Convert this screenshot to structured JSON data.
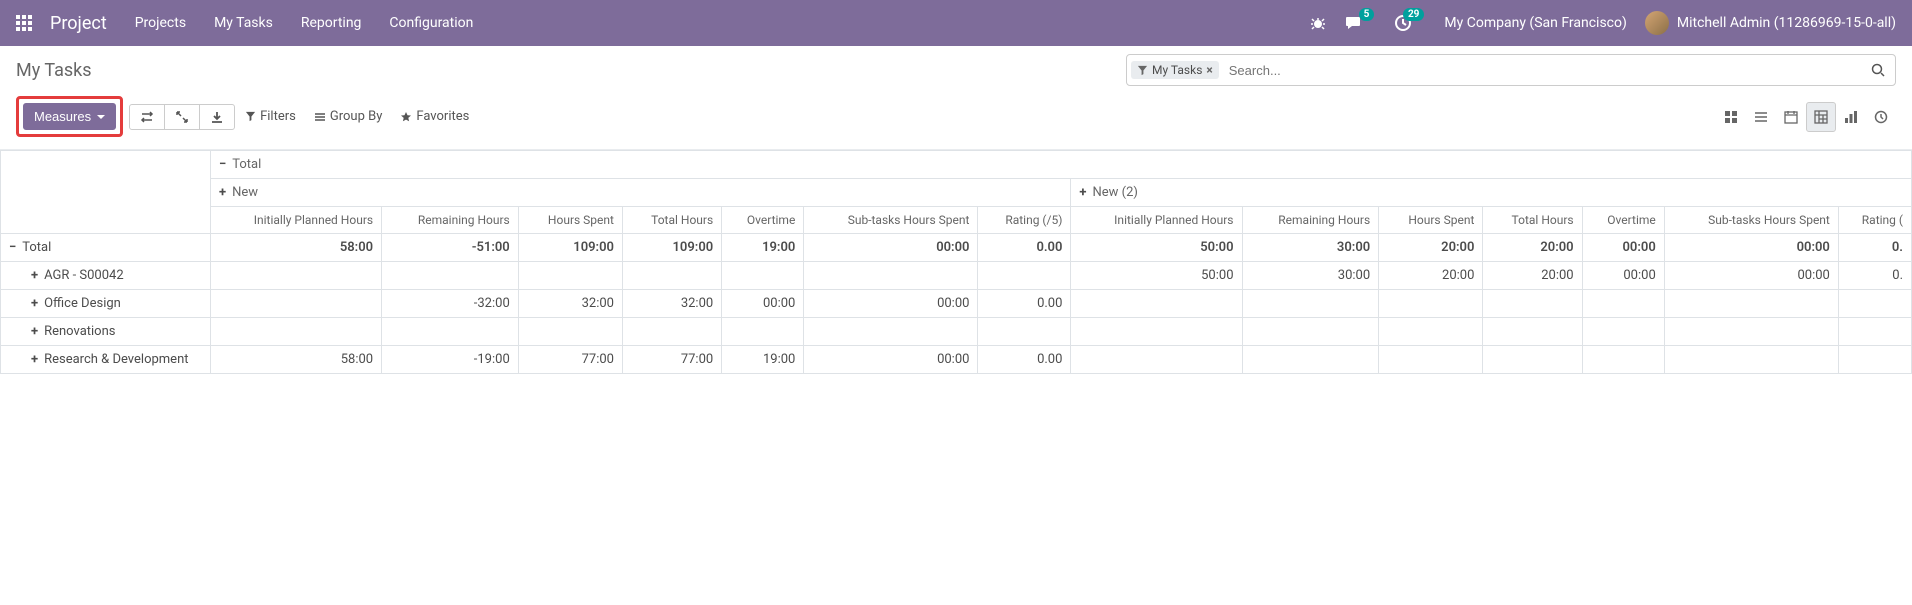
{
  "navbar": {
    "brand": "Project",
    "items": [
      "Projects",
      "My Tasks",
      "Reporting",
      "Configuration"
    ],
    "msg_badge": "5",
    "activity_badge": "29",
    "company": "My Company (San Francisco)",
    "user": "Mitchell Admin (11286969-15-0-all)"
  },
  "breadcrumb": "My Tasks",
  "search": {
    "tag": "My Tasks",
    "placeholder": "Search..."
  },
  "toolbar": {
    "measures": "Measures",
    "filters": "Filters",
    "groupby": "Group By",
    "favorites": "Favorites"
  },
  "pivot": {
    "total_label": "Total",
    "groups": [
      "New",
      "New (2)"
    ],
    "measures": [
      "Initially Planned Hours",
      "Remaining Hours",
      "Hours Spent",
      "Total Hours",
      "Overtime",
      "Sub-tasks Hours Spent",
      "Rating (/5)"
    ],
    "rows": [
      {
        "label": "Total",
        "type": "total",
        "toggle": "−",
        "g1": [
          "58:00",
          "-51:00",
          "109:00",
          "109:00",
          "19:00",
          "00:00",
          "0.00"
        ],
        "g2": [
          "50:00",
          "30:00",
          "20:00",
          "20:00",
          "00:00",
          "00:00",
          "0."
        ]
      },
      {
        "label": "AGR - S00042",
        "type": "sub",
        "toggle": "+",
        "g1": [
          "",
          "",
          "",
          "",
          "",
          "",
          ""
        ],
        "g2": [
          "50:00",
          "30:00",
          "20:00",
          "20:00",
          "00:00",
          "00:00",
          "0."
        ]
      },
      {
        "label": "Office Design",
        "type": "sub",
        "toggle": "+",
        "g1": [
          "",
          "-32:00",
          "32:00",
          "32:00",
          "00:00",
          "00:00",
          "0.00"
        ],
        "g2": [
          "",
          "",
          "",
          "",
          "",
          "",
          ""
        ]
      },
      {
        "label": "Renovations",
        "type": "sub",
        "toggle": "+",
        "g1": [
          "",
          "",
          "",
          "",
          "",
          "",
          ""
        ],
        "g2": [
          "",
          "",
          "",
          "",
          "",
          "",
          ""
        ]
      },
      {
        "label": "Research & Development",
        "type": "sub",
        "toggle": "+",
        "g1": [
          "58:00",
          "-19:00",
          "77:00",
          "77:00",
          "19:00",
          "00:00",
          "0.00"
        ],
        "g2": [
          "",
          "",
          "",
          "",
          "",
          "",
          ""
        ]
      }
    ],
    "measures_g2_last": "Rating ("
  }
}
